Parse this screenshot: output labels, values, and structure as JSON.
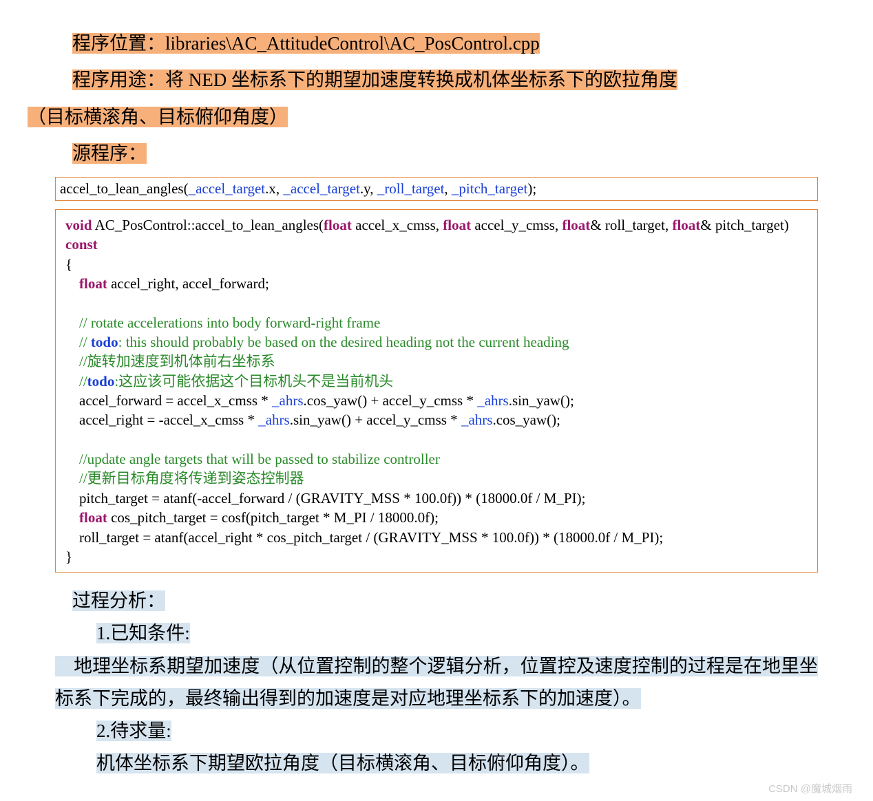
{
  "header": {
    "loc_label": "程序位置：",
    "loc_value": "libraries\\AC_AttitudeControl\\AC_PosControl.cpp",
    "use_label": "程序用途：",
    "use_value": "将 NED 坐标系下的期望加速度转换成机体坐标系下的欧拉角度",
    "use_value2": "（目标横滚角、目标俯仰角度）",
    "src_label": "源程序："
  },
  "call_line": {
    "fn": "accel_to_lean_angles(",
    "a1": "_accel_target",
    "a1s": ".x, ",
    "a2": "_accel_target",
    "a2s": ".y, ",
    "a3": "_roll_target",
    "a3s": ", ",
    "a4": "_pitch_target",
    "tail": ");"
  },
  "code": {
    "kw_void": "void",
    "sig1": " AC_PosControl::accel_to_lean_angles(",
    "kw_float1": "float",
    "p1": " accel_x_cmss, ",
    "kw_float2": "float",
    "p2": " accel_y_cmss, ",
    "kw_float3": "float",
    "p3": "& roll_target, ",
    "kw_float4": "float",
    "p4": "& pitch_target) ",
    "kw_const": "const",
    "brace_open": "{",
    "kw_float5": "float",
    "decl": " accel_right, accel_forward;",
    "c1": "// rotate accelerations into body forward-right frame",
    "c2a": "// ",
    "c2todo": "todo",
    "c2b": ": this should probably be based on the desired heading not the current heading",
    "c3": "//旋转加速度到机体前右坐标系",
    "c4a": "//",
    "c4todo": "todo",
    "c4b": ":这应该可能依据这个目标机头不是当前机头",
    "l1a": "accel_forward = accel_x_cmss * ",
    "l1ahrs1": "_ahrs",
    "l1b": ".cos_yaw() + accel_y_cmss * ",
    "l1ahrs2": "_ahrs",
    "l1c": ".sin_yaw();",
    "l2a": "accel_right = -accel_x_cmss * ",
    "l2ahrs1": "_ahrs",
    "l2b": ".sin_yaw() + accel_y_cmss * ",
    "l2ahrs2": "_ahrs",
    "l2c": ".cos_yaw();",
    "c5": "//update angle targets that will be passed to stabilize controller",
    "c6": "//更新目标角度将传递到姿态控制器",
    "l3": "pitch_target = atanf(-accel_forward / (GRAVITY_MSS * 100.0f)) * (18000.0f / M_PI);",
    "kw_float6": "float",
    "l4": " cos_pitch_target = cosf(pitch_target * M_PI / 18000.0f);",
    "l5": "roll_target = atanf(accel_right * cos_pitch_target / (GRAVITY_MSS * 100.0f)) * (18000.0f / M_PI);",
    "brace_close": "}"
  },
  "analysis": {
    "title": "过程分析：",
    "p1": "1.已知条件:",
    "p1b": "地理坐标系期望加速度（从位置控制的整个逻辑分析，位置控及速度控制的过程是在地里坐标系下完成的，最终输出得到的加速度是对应地理坐标系下的加速度）。",
    "p2": "2.待求量:",
    "p2b": "机体坐标系下期望欧拉角度（目标横滚角、目标俯仰角度）。"
  },
  "watermark": "CSDN @魔城烟雨"
}
